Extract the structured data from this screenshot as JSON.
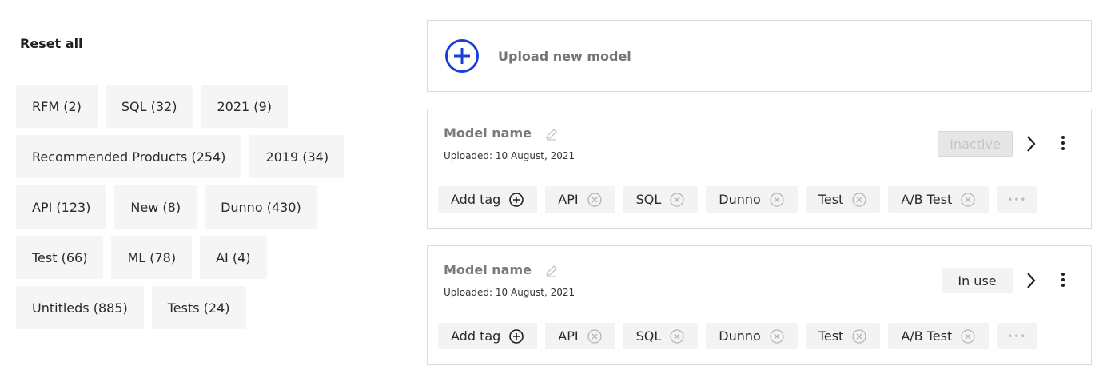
{
  "filters": {
    "reset_label": "Reset all",
    "chips": [
      "RFM (2)",
      "SQL (32)",
      "2021 (9)",
      "Recommended Products (254)",
      "2019 (34)",
      "API (123)",
      "New (8)",
      "Dunno (430)",
      "Test (66)",
      "ML (78)",
      "AI (4)",
      "Untitleds (885)",
      "Tests (24)"
    ]
  },
  "upload": {
    "label": "Upload new model"
  },
  "models": [
    {
      "name": "Model name",
      "uploaded": "Uploaded: 10 August, 2021",
      "status": "Inactive",
      "add_tag_label": "Add tag",
      "tags": [
        "API",
        "SQL",
        "Dunno",
        "Test",
        "A/B Test"
      ],
      "more_label": "•••"
    },
    {
      "name": "Model name",
      "uploaded": "Uploaded: 10 August, 2021",
      "status": "In use",
      "add_tag_label": "Add tag",
      "tags": [
        "API",
        "SQL",
        "Dunno",
        "Test",
        "A/B Test"
      ],
      "more_label": "•••"
    }
  ],
  "colors": {
    "accent": "#1b3fd6",
    "chip_bg": "#f5f5f5",
    "border": "#dcdcdc"
  },
  "icons": [
    "plus-circle-icon",
    "pencil-icon",
    "chevron-right-icon",
    "kebab-menu-icon",
    "remove-x-icon",
    "add-tag-plus-icon"
  ]
}
